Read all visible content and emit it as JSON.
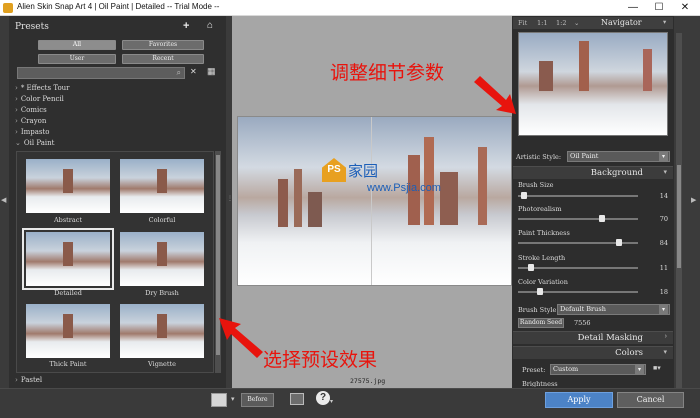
{
  "titlebar": {
    "title": "Alien Skin Snap Art 4 | Oil Paint | Detailed -- Trial Mode --",
    "minimize_glyph": "—",
    "maximize_glyph": "☐",
    "close_glyph": "✕"
  },
  "presets": {
    "title": "Presets",
    "add_glyph": "+",
    "home_glyph": "⌂",
    "filters": [
      {
        "label": "All",
        "active": true
      },
      {
        "label": "Favorites",
        "active": false
      },
      {
        "label": "User",
        "active": false
      },
      {
        "label": "Recent",
        "active": false
      }
    ],
    "search_placeholder": "",
    "tree": [
      {
        "label": "* Effects Tour",
        "expanded": false
      },
      {
        "label": "Color Pencil",
        "expanded": false
      },
      {
        "label": "Comics",
        "expanded": false
      },
      {
        "label": "Crayon",
        "expanded": false
      },
      {
        "label": "Impasto",
        "expanded": false
      },
      {
        "label": "Oil Paint",
        "expanded": true
      }
    ],
    "thumbnails": [
      {
        "label": "Abstract",
        "selected": false
      },
      {
        "label": "Colorful",
        "selected": false
      },
      {
        "label": "Detailed",
        "selected": true
      },
      {
        "label": "Dry Brush",
        "selected": false
      },
      {
        "label": "Thick Paint",
        "selected": false
      },
      {
        "label": "Vignette",
        "selected": false
      }
    ],
    "after_list": {
      "label": "Pastel",
      "expanded": false
    }
  },
  "canvas": {
    "filename": "27575.jpg",
    "watermark": {
      "ps": "PS",
      "brand": "家园",
      "url": "www.Psjia.com"
    }
  },
  "navigator": {
    "zoom_options": [
      "Fit",
      "1:1",
      "1:2"
    ],
    "title": "Navigator"
  },
  "settings": {
    "artistic_style_label": "Artistic Style:",
    "artistic_style_value": "Oil Paint",
    "background_section": "Background",
    "sliders": [
      {
        "label": "Brush Size",
        "value": 14,
        "fraction": 0.05
      },
      {
        "label": "Photorealism",
        "value": 70,
        "fraction": 0.7
      },
      {
        "label": "Paint Thickness",
        "value": 84,
        "fraction": 0.84
      },
      {
        "label": "Stroke Length",
        "value": 11,
        "fraction": 0.11
      },
      {
        "label": "Color Variation",
        "value": 18,
        "fraction": 0.18
      }
    ],
    "brush_style_label": "Brush Style",
    "brush_style_value": "Default Brush",
    "random_seed_button": "Random Seed",
    "random_seed_value": "7556",
    "detail_masking_section": "Detail Masking",
    "colors_section": "Colors",
    "preset_label": "Preset:",
    "preset_value": "Custom",
    "brightness_label": "Brightness"
  },
  "bottombar": {
    "before_label": "Before",
    "apply_label": "Apply",
    "cancel_label": "Cancel",
    "help_glyph": "?"
  },
  "annotations": {
    "top_right": "调整细节参数",
    "bottom_left": "选择预设效果",
    "color": "#e8140d"
  }
}
